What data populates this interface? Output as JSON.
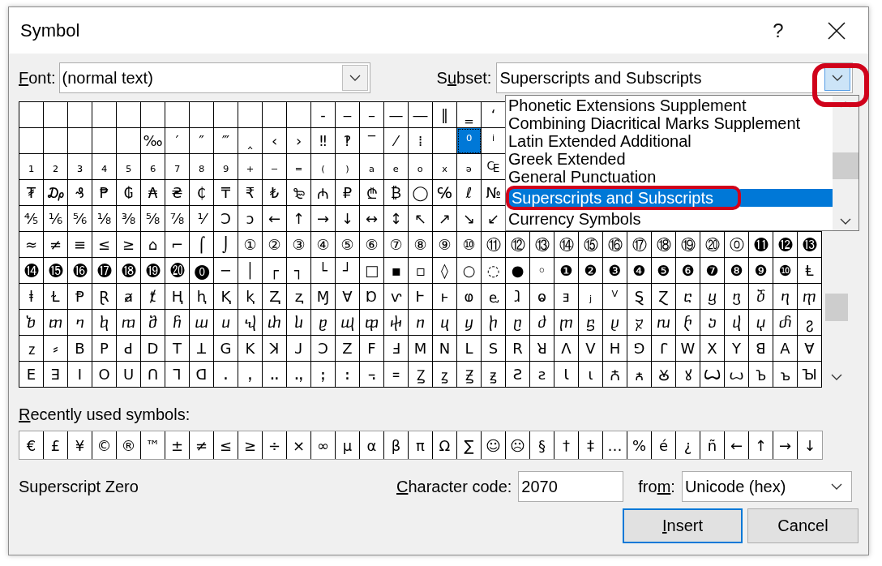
{
  "window": {
    "title": "Symbol",
    "help": "?"
  },
  "font": {
    "label": {
      "key": "F",
      "rest": "ont:"
    },
    "value": "(normal text)"
  },
  "subset": {
    "label": {
      "lead": "S",
      "key": "u",
      "rest": "bset:"
    },
    "value": "Superscripts and Subscripts",
    "open": true,
    "ring_on_button": true,
    "ring_on_selected": true,
    "items": [
      {
        "text": "Phonetic Extensions Supplement",
        "selected": false
      },
      {
        "text": "Combining Diacritical Marks Supplement",
        "selected": false
      },
      {
        "text": "Latin Extended Additional",
        "selected": false
      },
      {
        "text": "Greek Extended",
        "selected": false
      },
      {
        "text": "General Punctuation",
        "selected": false
      },
      {
        "text": "Superscripts and Subscripts",
        "selected": true
      },
      {
        "text": "Currency Symbols",
        "selected": false
      }
    ]
  },
  "grid": {
    "rows": [
      [
        {
          "selected": false
        },
        {
          "selected": false
        },
        {
          "selected": false
        },
        {
          "selected": false
        },
        {
          "selected": false
        },
        {
          "selected": false
        },
        {
          "selected": false
        },
        {
          "selected": false
        },
        {
          "selected": false
        },
        {
          "selected": false
        },
        {
          "selected": false
        },
        {
          "selected": false
        },
        {
          "symbol": "‐",
          "selected": false
        },
        {
          "symbol": "‒",
          "selected": false
        },
        {
          "symbol": "–",
          "selected": false
        },
        {
          "symbol": "—",
          "selected": false
        },
        {
          "symbol": "―",
          "selected": false
        },
        {
          "symbol": "‖",
          "selected": false
        },
        {
          "symbol": "‗",
          "selected": false
        },
        {
          "symbol": "‘",
          "selected": false
        }
      ],
      [
        {
          "selected": false
        },
        {
          "selected": false
        },
        {
          "selected": false
        },
        {
          "selected": false
        },
        {
          "selected": false
        },
        {
          "symbol": "‰",
          "selected": false
        },
        {
          "symbol": "′",
          "selected": false
        },
        {
          "symbol": "″",
          "selected": false
        },
        {
          "symbol": "‴",
          "selected": false
        },
        {
          "symbol": "‸",
          "selected": false
        },
        {
          "symbol": "‹",
          "selected": false
        },
        {
          "symbol": "›",
          "selected": false
        },
        {
          "symbol": "‼",
          "selected": false
        },
        {
          "symbol": "‽",
          "selected": false
        },
        {
          "symbol": "‾",
          "selected": false
        },
        {
          "symbol": "⁄",
          "selected": false
        },
        {
          "symbol": "⁞",
          "selected": false
        },
        {
          "selected": false
        },
        {
          "symbol": "⁰",
          "selected": true
        },
        {
          "symbol": "ⁱ",
          "selected": false
        }
      ],
      [
        {
          "symbol": "₁",
          "selected": false
        },
        {
          "symbol": "₂",
          "selected": false
        },
        {
          "symbol": "₃",
          "selected": false
        },
        {
          "symbol": "₄",
          "selected": false
        },
        {
          "symbol": "₅",
          "selected": false
        },
        {
          "symbol": "₆",
          "selected": false
        },
        {
          "symbol": "₇",
          "selected": false
        },
        {
          "symbol": "₈",
          "selected": false
        },
        {
          "symbol": "₉",
          "selected": false
        },
        {
          "symbol": "₊",
          "selected": false
        },
        {
          "symbol": "₋",
          "selected": false
        },
        {
          "symbol": "₌",
          "selected": false
        },
        {
          "symbol": "₍",
          "selected": false
        },
        {
          "symbol": "₎",
          "selected": false
        },
        {
          "symbol": "ₐ",
          "selected": false
        },
        {
          "symbol": "ₑ",
          "selected": false
        },
        {
          "symbol": "ₒ",
          "selected": false
        },
        {
          "symbol": "ₓ",
          "selected": false
        },
        {
          "symbol": "ₔ",
          "selected": false
        },
        {
          "symbol": "₠",
          "selected": false
        }
      ],
      [
        {
          "symbol": "₮",
          "selected": false
        },
        {
          "symbol": "₯",
          "selected": false
        },
        {
          "symbol": "₰",
          "selected": false
        },
        {
          "symbol": "₱",
          "selected": false
        },
        {
          "symbol": "₲",
          "selected": false
        },
        {
          "symbol": "₳",
          "selected": false
        },
        {
          "symbol": "₴",
          "selected": false
        },
        {
          "symbol": "₵",
          "selected": false
        },
        {
          "symbol": "₸",
          "selected": false
        },
        {
          "symbol": "₹",
          "selected": false
        },
        {
          "symbol": "₺",
          "selected": false
        },
        {
          "symbol": "₻",
          "selected": false
        },
        {
          "symbol": "₼",
          "selected": false
        },
        {
          "symbol": "₽",
          "selected": false
        },
        {
          "symbol": "₾",
          "selected": false
        },
        {
          "symbol": "₿",
          "selected": false
        },
        {
          "symbol": "◯",
          "selected": false
        },
        {
          "symbol": "℅",
          "selected": false
        },
        {
          "symbol": "ℓ",
          "selected": false
        },
        {
          "symbol": "№",
          "selected": false
        }
      ],
      [
        {
          "symbol": "⅘",
          "selected": false
        },
        {
          "symbol": "⅙",
          "selected": false
        },
        {
          "symbol": "⅚",
          "selected": false
        },
        {
          "symbol": "⅛",
          "selected": false
        },
        {
          "symbol": "⅜",
          "selected": false
        },
        {
          "symbol": "⅝",
          "selected": false
        },
        {
          "symbol": "⅞",
          "selected": false
        },
        {
          "symbol": "⅟",
          "selected": false
        },
        {
          "symbol": "Ↄ",
          "selected": false
        },
        {
          "symbol": "ↄ",
          "selected": false
        },
        {
          "symbol": "←",
          "selected": false
        },
        {
          "symbol": "↑",
          "selected": false
        },
        {
          "symbol": "→",
          "selected": false
        },
        {
          "symbol": "↓",
          "selected": false
        },
        {
          "symbol": "↔",
          "selected": false
        },
        {
          "symbol": "↕",
          "selected": false
        },
        {
          "symbol": "↖",
          "selected": false
        },
        {
          "symbol": "↗",
          "selected": false
        },
        {
          "symbol": "↘",
          "selected": false
        },
        {
          "symbol": "↙",
          "selected": false
        }
      ],
      [
        {
          "symbol": "≈",
          "selected": false
        },
        {
          "symbol": "≠",
          "selected": false
        },
        {
          "symbol": "≡",
          "selected": false
        },
        {
          "symbol": "≤",
          "selected": false
        },
        {
          "symbol": "≥",
          "selected": false
        },
        {
          "symbol": "⌂",
          "selected": false
        },
        {
          "symbol": "⌐",
          "selected": false
        },
        {
          "symbol": "⌠",
          "selected": false
        },
        {
          "symbol": "⌡",
          "selected": false
        },
        {
          "symbol": "①",
          "selected": false
        },
        {
          "symbol": "②",
          "selected": false
        },
        {
          "symbol": "③",
          "selected": false
        },
        {
          "symbol": "④",
          "selected": false
        },
        {
          "symbol": "⑤",
          "selected": false
        },
        {
          "symbol": "⑥",
          "selected": false
        },
        {
          "symbol": "⑦",
          "selected": false
        },
        {
          "symbol": "⑧",
          "selected": false
        },
        {
          "symbol": "⑨",
          "selected": false
        },
        {
          "symbol": "⑩",
          "selected": false
        },
        {
          "symbol": "⑪",
          "selected": false
        },
        {
          "symbol": "⑫",
          "selected": false
        },
        {
          "symbol": "⑬",
          "selected": false
        },
        {
          "symbol": "⑭",
          "selected": false
        },
        {
          "symbol": "⑮",
          "selected": false
        },
        {
          "symbol": "⑯",
          "selected": false
        },
        {
          "symbol": "⑰",
          "selected": false
        },
        {
          "symbol": "⑱",
          "selected": false
        },
        {
          "symbol": "⑲",
          "selected": false
        },
        {
          "symbol": "⑳",
          "selected": false
        },
        {
          "symbol": "⓪",
          "selected": false
        },
        {
          "symbol": "⓫",
          "selected": false
        },
        {
          "symbol": "⓬",
          "selected": false
        },
        {
          "symbol": "⓭",
          "selected": false
        }
      ],
      [
        {
          "symbol": "⓮",
          "selected": false
        },
        {
          "symbol": "⓯",
          "selected": false
        },
        {
          "symbol": "⓰",
          "selected": false
        },
        {
          "symbol": "⓱",
          "selected": false
        },
        {
          "symbol": "⓲",
          "selected": false
        },
        {
          "symbol": "⓳",
          "selected": false
        },
        {
          "symbol": "⓴",
          "selected": false
        },
        {
          "symbol": "⓿",
          "selected": false
        },
        {
          "symbol": "─",
          "selected": false
        },
        {
          "symbol": "│",
          "selected": false
        },
        {
          "symbol": "┌",
          "selected": false
        },
        {
          "symbol": "┐",
          "selected": false
        },
        {
          "symbol": "└",
          "selected": false
        },
        {
          "symbol": "┘",
          "selected": false
        },
        {
          "symbol": "□",
          "selected": false
        },
        {
          "symbol": "▪",
          "selected": false
        },
        {
          "symbol": "▫",
          "selected": false
        },
        {
          "symbol": "◊",
          "selected": false
        },
        {
          "symbol": "○",
          "selected": false
        },
        {
          "symbol": "◌",
          "selected": false
        },
        {
          "symbol": "●",
          "selected": false
        },
        {
          "symbol": "◦",
          "selected": false
        },
        {
          "symbol": "❶",
          "selected": false
        },
        {
          "symbol": "❷",
          "selected": false
        },
        {
          "symbol": "❸",
          "selected": false
        },
        {
          "symbol": "❹",
          "selected": false
        },
        {
          "symbol": "❺",
          "selected": false
        },
        {
          "symbol": "❻",
          "selected": false
        },
        {
          "symbol": "❼",
          "selected": false
        },
        {
          "symbol": "❽",
          "selected": false
        },
        {
          "symbol": "❾",
          "selected": false
        },
        {
          "symbol": "❿",
          "selected": false
        },
        {
          "symbol": "Ⱡ",
          "selected": false
        }
      ],
      [
        {
          "symbol": "ⱡ",
          "selected": false
        },
        {
          "symbol": "Ɫ",
          "selected": false
        },
        {
          "symbol": "Ᵽ",
          "selected": false
        },
        {
          "symbol": "Ɽ",
          "selected": false
        },
        {
          "symbol": "ⱥ",
          "selected": false
        },
        {
          "symbol": "ⱦ",
          "selected": false
        },
        {
          "symbol": "Ⱨ",
          "selected": false
        },
        {
          "symbol": "ⱨ",
          "selected": false
        },
        {
          "symbol": "Ⱪ",
          "selected": false
        },
        {
          "symbol": "ⱪ",
          "selected": false
        },
        {
          "symbol": "Ⱬ",
          "selected": false
        },
        {
          "symbol": "ⱬ",
          "selected": false
        },
        {
          "symbol": "Ɱ",
          "selected": false
        },
        {
          "symbol": "Ɐ",
          "selected": false
        },
        {
          "symbol": "Ɒ",
          "selected": false
        },
        {
          "symbol": "ⱱ",
          "selected": false
        },
        {
          "symbol": "Ⱶ",
          "selected": false
        },
        {
          "symbol": "ⱶ",
          "selected": false
        },
        {
          "symbol": "ⱷ",
          "selected": false
        },
        {
          "symbol": "ⱸ",
          "selected": false
        },
        {
          "symbol": "ⱹ",
          "selected": false
        },
        {
          "symbol": "ⱺ",
          "selected": false
        },
        {
          "symbol": "ⱻ",
          "selected": false
        },
        {
          "symbol": "ⱼ",
          "selected": false
        },
        {
          "symbol": "ⱽ",
          "selected": false
        },
        {
          "symbol": "Ȿ",
          "selected": false
        },
        {
          "symbol": "Ɀ",
          "selected": false
        },
        {
          "symbol": "ⴀ",
          "selected": false
        },
        {
          "symbol": "ⴁ",
          "selected": false
        },
        {
          "symbol": "ⴂ",
          "selected": false
        },
        {
          "symbol": "ⴃ",
          "selected": false
        },
        {
          "symbol": "ⴄ",
          "selected": false
        },
        {
          "symbol": "ⴅ",
          "selected": false
        }
      ],
      [
        {
          "symbol": "ⴆ",
          "selected": false
        },
        {
          "symbol": "ⴇ",
          "selected": false
        },
        {
          "symbol": "ⴈ",
          "selected": false
        },
        {
          "symbol": "ⴉ",
          "selected": false
        },
        {
          "symbol": "ⴊ",
          "selected": false
        },
        {
          "symbol": "ⴋ",
          "selected": false
        },
        {
          "symbol": "ⴌ",
          "selected": false
        },
        {
          "symbol": "ⴍ",
          "selected": false
        },
        {
          "symbol": "ⴎ",
          "selected": false
        },
        {
          "symbol": "ⴏ",
          "selected": false
        },
        {
          "symbol": "ⴐ",
          "selected": false
        },
        {
          "symbol": "ⴑ",
          "selected": false
        },
        {
          "symbol": "ⴒ",
          "selected": false
        },
        {
          "symbol": "ⴓ",
          "selected": false
        },
        {
          "symbol": "ⴔ",
          "selected": false
        },
        {
          "symbol": "ⴕ",
          "selected": false
        },
        {
          "symbol": "ⴖ",
          "selected": false
        },
        {
          "symbol": "ⴗ",
          "selected": false
        },
        {
          "symbol": "ⴘ",
          "selected": false
        },
        {
          "symbol": "ⴙ",
          "selected": false
        },
        {
          "symbol": "ⴚ",
          "selected": false
        },
        {
          "symbol": "ⴛ",
          "selected": false
        },
        {
          "symbol": "ⴜ",
          "selected": false
        },
        {
          "symbol": "ⴝ",
          "selected": false
        },
        {
          "symbol": "ⴞ",
          "selected": false
        },
        {
          "symbol": "ⴟ",
          "selected": false
        },
        {
          "symbol": "ⴠ",
          "selected": false
        },
        {
          "symbol": "ⴡ",
          "selected": false
        },
        {
          "symbol": "ⴢ",
          "selected": false
        },
        {
          "symbol": "ⴣ",
          "selected": false
        },
        {
          "symbol": "ⴤ",
          "selected": false
        },
        {
          "symbol": "ⴥ",
          "selected": false
        },
        {
          "symbol": "ⴧ",
          "selected": false
        }
      ],
      [
        {
          "symbol": "ⴭ",
          "selected": false
        },
        {
          "symbol": "⸗",
          "selected": false
        },
        {
          "symbol": "ꓐ",
          "selected": false
        },
        {
          "symbol": "ꓑ",
          "selected": false
        },
        {
          "symbol": "ꓒ",
          "selected": false
        },
        {
          "symbol": "ꓓ",
          "selected": false
        },
        {
          "symbol": "ꓔ",
          "selected": false
        },
        {
          "symbol": "ꓕ",
          "selected": false
        },
        {
          "symbol": "ꓖ",
          "selected": false
        },
        {
          "symbol": "ꓗ",
          "selected": false
        },
        {
          "symbol": "ꓘ",
          "selected": false
        },
        {
          "symbol": "ꓙ",
          "selected": false
        },
        {
          "symbol": "ꓛ",
          "selected": false
        },
        {
          "symbol": "ꓜ",
          "selected": false
        },
        {
          "symbol": "ꓝ",
          "selected": false
        },
        {
          "symbol": "ꓞ",
          "selected": false
        },
        {
          "symbol": "ꓟ",
          "selected": false
        },
        {
          "symbol": "ꓠ",
          "selected": false
        },
        {
          "symbol": "ꓡ",
          "selected": false
        },
        {
          "symbol": "ꓢ",
          "selected": false
        },
        {
          "symbol": "ꓣ",
          "selected": false
        },
        {
          "symbol": "ꓤ",
          "selected": false
        },
        {
          "symbol": "ꓥ",
          "selected": false
        },
        {
          "symbol": "ꓦ",
          "selected": false
        },
        {
          "symbol": "ꓧ",
          "selected": false
        },
        {
          "symbol": "ꓨ",
          "selected": false
        },
        {
          "symbol": "ꓩ",
          "selected": false
        },
        {
          "symbol": "ꓪ",
          "selected": false
        },
        {
          "symbol": "ꓫ",
          "selected": false
        },
        {
          "symbol": "ꓬ",
          "selected": false
        },
        {
          "symbol": "ꓭ",
          "selected": false
        },
        {
          "symbol": "ꓮ",
          "selected": false
        },
        {
          "symbol": "ꓯ",
          "selected": false
        }
      ],
      [
        {
          "symbol": "ꓰ",
          "selected": false
        },
        {
          "symbol": "ꓱ",
          "selected": false
        },
        {
          "symbol": "ꓲ",
          "selected": false
        },
        {
          "symbol": "ꓳ",
          "selected": false
        },
        {
          "symbol": "ꓴ",
          "selected": false
        },
        {
          "symbol": "ꓵ",
          "selected": false
        },
        {
          "symbol": "ꓶ",
          "selected": false
        },
        {
          "symbol": "ꓷ",
          "selected": false
        },
        {
          "symbol": "ꓸ",
          "selected": false
        },
        {
          "symbol": "ꓹ",
          "selected": false
        },
        {
          "symbol": "ꓺ",
          "selected": false
        },
        {
          "symbol": "ꓻ",
          "selected": false
        },
        {
          "symbol": "ꓼ",
          "selected": false
        },
        {
          "symbol": "ꓽ",
          "selected": false
        },
        {
          "symbol": "꓾",
          "selected": false
        },
        {
          "symbol": "꓿",
          "selected": false
        },
        {
          "symbol": "Ꙁ",
          "selected": false
        },
        {
          "symbol": "ꙁ",
          "selected": false
        },
        {
          "symbol": "Ꙃ",
          "selected": false
        },
        {
          "symbol": "ꙃ",
          "selected": false
        },
        {
          "symbol": "Ꙅ",
          "selected": false
        },
        {
          "symbol": "ꙅ",
          "selected": false
        },
        {
          "symbol": "Ꙇ",
          "selected": false
        },
        {
          "symbol": "ꙇ",
          "selected": false
        },
        {
          "symbol": "Ꙉ",
          "selected": false
        },
        {
          "symbol": "ꙉ",
          "selected": false
        },
        {
          "symbol": "Ꙋ",
          "selected": false
        },
        {
          "symbol": "ꙋ",
          "selected": false
        },
        {
          "symbol": "Ꙍ",
          "selected": false
        },
        {
          "symbol": "ꙍ",
          "selected": false
        },
        {
          "symbol": "Ꙏ",
          "selected": false
        },
        {
          "symbol": "ꙏ",
          "selected": false
        },
        {
          "symbol": "Ꙑ",
          "selected": false
        }
      ]
    ]
  },
  "recent": {
    "label": {
      "key": "R",
      "rest": "ecently used symbols:"
    },
    "symbols": [
      "€",
      "£",
      "¥",
      "©",
      "®",
      "™",
      "±",
      "≠",
      "≤",
      "≥",
      "÷",
      "×",
      "∞",
      "µ",
      "α",
      "β",
      "π",
      "Ω",
      "∑",
      "☺",
      "☹",
      "§",
      "†",
      "‡",
      "…",
      "%",
      "é",
      "¿",
      "ñ",
      "←",
      "↑",
      "→",
      "↓"
    ]
  },
  "char_name": "Superscript Zero",
  "char_code": {
    "label": {
      "key": "C",
      "rest": "haracter code:"
    },
    "value": "2070"
  },
  "from": {
    "label": {
      "lead": "fro",
      "key": "m",
      "rest": ":"
    },
    "value": "Unicode (hex)"
  },
  "buttons": [
    {
      "label": {
        "key": "I",
        "rest": "nsert"
      },
      "default": true
    },
    {
      "label": {
        "text": "Cancel"
      },
      "default": false
    }
  ]
}
